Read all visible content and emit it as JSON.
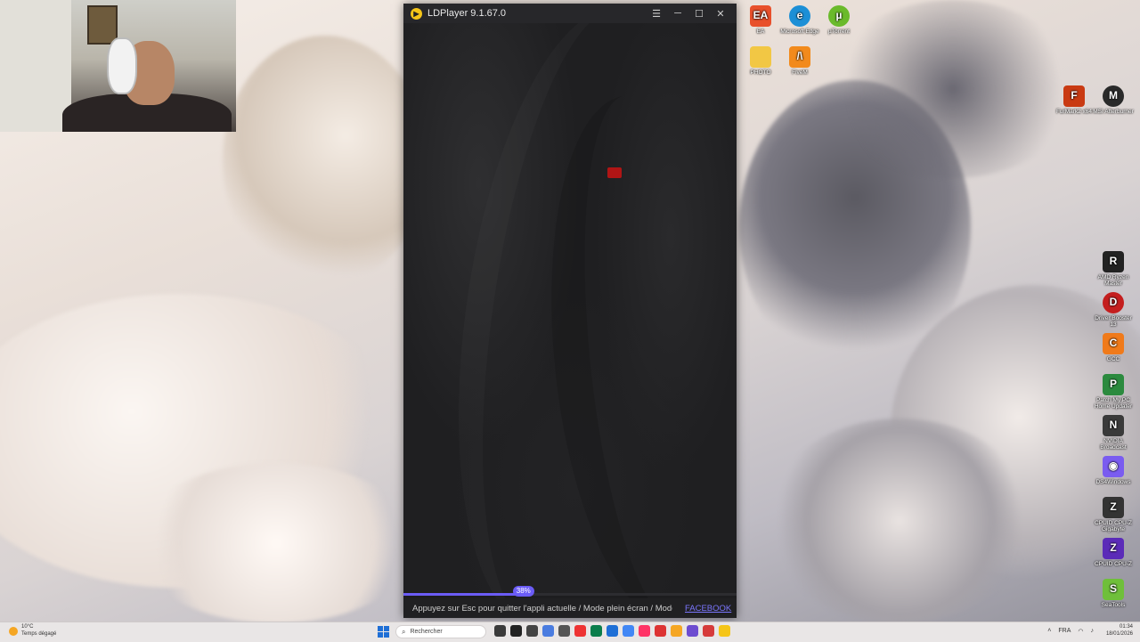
{
  "window": {
    "title": "LDPlayer 9.1.67.0",
    "menu_icon": "hamburger-menu-icon",
    "minimize_icon": "minimize-icon",
    "maximize_icon": "maximize-icon",
    "close_icon": "close-icon"
  },
  "emulator": {
    "progress_label": "38%",
    "progress_value": 0.38,
    "hint_text": "Appuyez sur Esc pour quitter l'appli actuelle / Mode plein écran / Mode M",
    "facebook_link": "FACEBOOK"
  },
  "desktop": {
    "icons_top": [
      {
        "label": "EA",
        "color": "#e8502b",
        "glyph": "EA"
      },
      {
        "label": "Microsoft Edge",
        "color": "#1c8fd6",
        "glyph": "e"
      },
      {
        "label": "µTorrent",
        "color": "#6aba2b",
        "glyph": "µ"
      },
      {
        "label": "PHOTO",
        "color": "#f2c744",
        "glyph": ""
      },
      {
        "label": "FiveM",
        "color": "#f28a1c",
        "glyph": "/\\"
      }
    ],
    "icons_right": [
      {
        "label": "AMD Ryzen Master",
        "color": "#222",
        "glyph": "R"
      },
      {
        "label": "Driver Booster 13",
        "color": "#c41e1e",
        "glyph": "D"
      },
      {
        "label": "GCC",
        "color": "#f07a1a",
        "glyph": "C"
      },
      {
        "label": "Patch My PC Home Updater",
        "color": "#2b8a3e",
        "glyph": "P"
      },
      {
        "label": "NVIDIA Broadcast",
        "color": "#3a3a3a",
        "glyph": "N"
      },
      {
        "label": "DS4Windows",
        "color": "#7a5cf0",
        "glyph": "◉"
      },
      {
        "label": "CPUID CPU-Z Gigabyte",
        "color": "#333",
        "glyph": "Z"
      },
      {
        "label": "CPUID CPU-Z",
        "color": "#5b2bb8",
        "glyph": "Z"
      },
      {
        "label": "SeaTools",
        "color": "#6fbf3a",
        "glyph": "S"
      }
    ],
    "icons_right_upper": [
      {
        "label": "FurMark2 x64",
        "color": "#c93a12",
        "glyph": "F"
      },
      {
        "label": "MSI Afterburner",
        "color": "#2a2a2a",
        "glyph": "M"
      }
    ]
  },
  "taskbar": {
    "weather_temp": "10°C",
    "weather_desc": "Temps dégagé",
    "search_placeholder": "Rechercher",
    "language": "FRA",
    "time": "01:34",
    "date": "18/01/2026",
    "apps": [
      "#3a3a3a",
      "#222",
      "#444",
      "#4a7ce0",
      "#555",
      "#e33",
      "#0a7d4b",
      "#1f6fd6",
      "#4287f5",
      "#ff3366",
      "#d33",
      "#f5a623",
      "#6d4cd0",
      "#d63b3b",
      "#f5c518"
    ]
  }
}
